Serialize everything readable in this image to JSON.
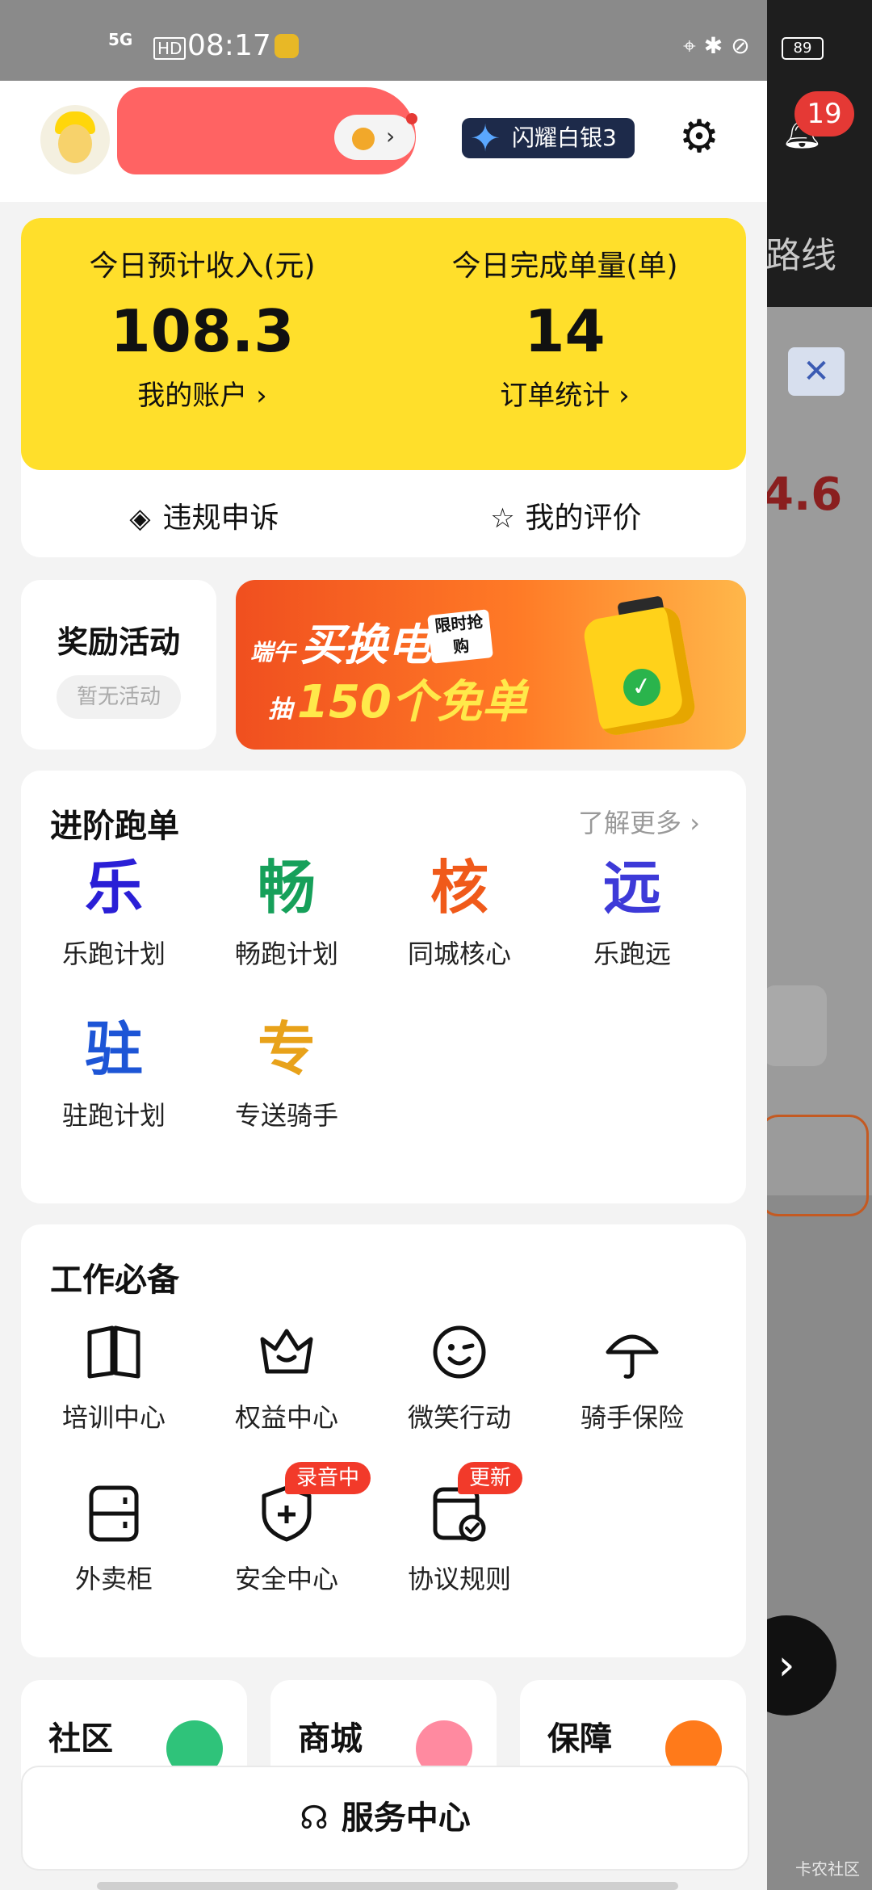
{
  "status_bar": {
    "network": "5G",
    "hd": "HD",
    "time": "08:17",
    "battery": "89"
  },
  "background": {
    "route_text": "路线",
    "bell_badge": "19",
    "amount_fragment": "4.6",
    "watermark": "卡农社区"
  },
  "header": {
    "rank_label": "闪耀白银3"
  },
  "earnings": {
    "income_label": "今日预计收入(元)",
    "income_value": "108.3",
    "account_link": "我的账户",
    "orders_label": "今日完成单量(单)",
    "orders_value": "14",
    "orders_link": "订单统计",
    "appeal_label": "违规申诉",
    "review_label": "我的评价"
  },
  "rewards": {
    "title": "奖励活动",
    "empty": "暂无活动"
  },
  "banner": {
    "pre1": "端午",
    "main": "买换电",
    "tag": "限时抢购",
    "pre2": "抽",
    "sub": "150个免单"
  },
  "advanced": {
    "title": "进阶跑单",
    "more": "了解更多",
    "items": [
      {
        "glyph": "乐",
        "label": "乐跑计划",
        "color": "#2a1fd6"
      },
      {
        "glyph": "畅",
        "label": "畅跑计划",
        "color": "#16a05a"
      },
      {
        "glyph": "核",
        "label": "同城核心",
        "color": "#f05a1a"
      },
      {
        "glyph": "远",
        "label": "乐跑远",
        "color": "#3d3ad8"
      },
      {
        "glyph": "驻",
        "label": "驻跑计划",
        "color": "#1d55d6"
      },
      {
        "glyph": "专",
        "label": "专送骑手",
        "color": "#e8a21a"
      }
    ]
  },
  "work": {
    "title": "工作必备",
    "items": [
      {
        "label": "培训中心",
        "icon": "book-icon"
      },
      {
        "label": "权益中心",
        "icon": "crown-icon"
      },
      {
        "label": "微笑行动",
        "icon": "smile-icon"
      },
      {
        "label": "骑手保险",
        "icon": "umbrella-icon"
      },
      {
        "label": "外卖柜",
        "icon": "locker-icon"
      },
      {
        "label": "安全中心",
        "icon": "shield-icon",
        "badge": "录音中"
      },
      {
        "label": "协议规则",
        "icon": "document-check-icon",
        "badge": "更新"
      }
    ]
  },
  "mini_cards": [
    {
      "title": "社区",
      "color": "#2fc37a"
    },
    {
      "title": "商城",
      "color": "#ff8aa0"
    },
    {
      "title": "保障",
      "color": "#ff7a1a"
    }
  ],
  "service": {
    "label": "服务中心"
  }
}
